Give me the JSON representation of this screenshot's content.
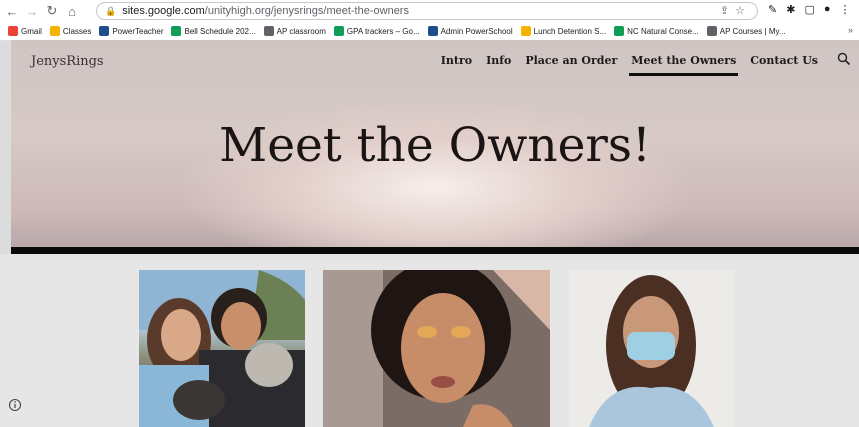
{
  "browser": {
    "url_host": "sites.google.com",
    "url_path": "/unityhigh.org/jenysrings/meet-the-owners",
    "bookmarks": [
      {
        "label": "Gmail",
        "color": "#ea4335"
      },
      {
        "label": "Classes",
        "color": "#f4b400"
      },
      {
        "label": "PowerTeacher",
        "color": "#1e4e8c"
      },
      {
        "label": "Bell Schedule 202...",
        "color": "#0f9d58"
      },
      {
        "label": "AP classroom",
        "color": "#5f6368"
      },
      {
        "label": "GPA trackers – Go...",
        "color": "#0f9d58"
      },
      {
        "label": "Admin PowerSchool",
        "color": "#1e4e8c"
      },
      {
        "label": "Lunch Detention S...",
        "color": "#f4b400"
      },
      {
        "label": "NC Natural Conse...",
        "color": "#0f9d58"
      },
      {
        "label": "AP Courses | My...",
        "color": "#5f6368"
      }
    ],
    "more": "»"
  },
  "site": {
    "title": "JenysRings",
    "nav": [
      {
        "label": "Intro"
      },
      {
        "label": "Info"
      },
      {
        "label": "Place an Order"
      },
      {
        "label": "Meet the Owners",
        "active": true
      },
      {
        "label": "Contact Us"
      }
    ],
    "heading": "Meet the Owners!"
  }
}
